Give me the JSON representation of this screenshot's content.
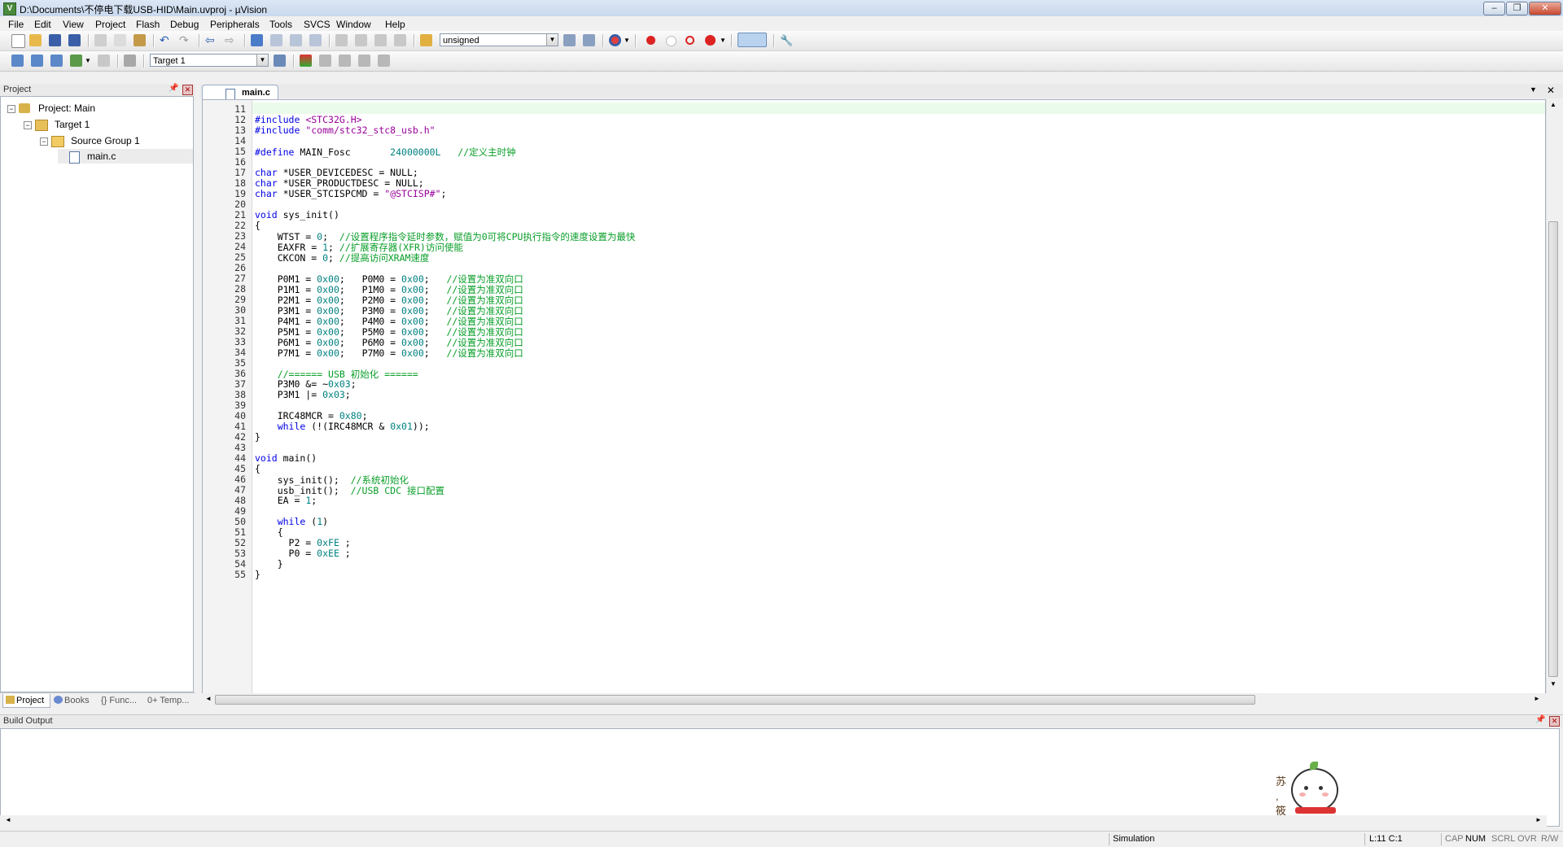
{
  "window": {
    "title": "D:\\Documents\\不停电下载USB-HID\\Main.uvproj - µVision"
  },
  "menu": [
    "File",
    "Edit",
    "View",
    "Project",
    "Flash",
    "Debug",
    "Peripherals",
    "Tools",
    "SVCS",
    "Window",
    "Help"
  ],
  "toolbar": {
    "type_combo": "unsigned",
    "target_combo": "Target 1"
  },
  "project_panel": {
    "header": "Project",
    "tree": {
      "project": "Project: Main",
      "target": "Target 1",
      "group": "Source Group 1",
      "file": "main.c"
    },
    "tabs": [
      "Project",
      "Books",
      "{} Func...",
      "0+ Temp..."
    ]
  },
  "editor": {
    "tab": "main.c",
    "lines": [
      {
        "n": "11",
        "t": ""
      },
      {
        "n": "12",
        "t": "#include <STC32G.H>"
      },
      {
        "n": "13",
        "t": "#include \"comm/stc32_stc8_usb.h\""
      },
      {
        "n": "14",
        "t": ""
      },
      {
        "n": "15",
        "t": "#define MAIN_Fosc       24000000L   //定义主时钟"
      },
      {
        "n": "16",
        "t": ""
      },
      {
        "n": "17",
        "t": "char *USER_DEVICEDESC = NULL;"
      },
      {
        "n": "18",
        "t": "char *USER_PRODUCTDESC = NULL;"
      },
      {
        "n": "19",
        "t": "char *USER_STCISPCMD = \"@STCISP#\";"
      },
      {
        "n": "20",
        "t": ""
      },
      {
        "n": "21",
        "t": "void sys_init()"
      },
      {
        "n": "22",
        "t": "{"
      },
      {
        "n": "23",
        "t": "    WTST = 0;  //设置程序指令延时参数，赋值为0可将CPU执行指令的速度设置为最快"
      },
      {
        "n": "24",
        "t": "    EAXFR = 1; //扩展寄存器(XFR)访问使能"
      },
      {
        "n": "25",
        "t": "    CKCON = 0; //提高访问XRAM速度"
      },
      {
        "n": "26",
        "t": ""
      },
      {
        "n": "27",
        "t": "    P0M1 = 0x00;   P0M0 = 0x00;   //设置为准双向口"
      },
      {
        "n": "28",
        "t": "    P1M1 = 0x00;   P1M0 = 0x00;   //设置为准双向口"
      },
      {
        "n": "29",
        "t": "    P2M1 = 0x00;   P2M0 = 0x00;   //设置为准双向口"
      },
      {
        "n": "30",
        "t": "    P3M1 = 0x00;   P3M0 = 0x00;   //设置为准双向口"
      },
      {
        "n": "31",
        "t": "    P4M1 = 0x00;   P4M0 = 0x00;   //设置为准双向口"
      },
      {
        "n": "32",
        "t": "    P5M1 = 0x00;   P5M0 = 0x00;   //设置为准双向口"
      },
      {
        "n": "33",
        "t": "    P6M1 = 0x00;   P6M0 = 0x00;   //设置为准双向口"
      },
      {
        "n": "34",
        "t": "    P7M1 = 0x00;   P7M0 = 0x00;   //设置为准双向口"
      },
      {
        "n": "35",
        "t": ""
      },
      {
        "n": "36",
        "t": "    //====== USB 初始化 ======"
      },
      {
        "n": "37",
        "t": "    P3M0 &= ~0x03;"
      },
      {
        "n": "38",
        "t": "    P3M1 |= 0x03;"
      },
      {
        "n": "39",
        "t": ""
      },
      {
        "n": "40",
        "t": "    IRC48MCR = 0x80;"
      },
      {
        "n": "41",
        "t": "    while (!(IRC48MCR & 0x01));"
      },
      {
        "n": "42",
        "t": "}"
      },
      {
        "n": "43",
        "t": ""
      },
      {
        "n": "44",
        "t": "void main()"
      },
      {
        "n": "45",
        "t": "{"
      },
      {
        "n": "46",
        "t": "    sys_init();  //系统初始化"
      },
      {
        "n": "47",
        "t": "    usb_init();  //USB CDC 接口配置"
      },
      {
        "n": "48",
        "t": "    EA = 1;"
      },
      {
        "n": "49",
        "t": ""
      },
      {
        "n": "50",
        "t": "    while (1)"
      },
      {
        "n": "51",
        "t": "    {"
      },
      {
        "n": "52",
        "t": "      P2 = 0xFE ;"
      },
      {
        "n": "53",
        "t": "      P0 = 0xEE ;"
      },
      {
        "n": "54",
        "t": "    }"
      },
      {
        "n": "55",
        "t": "}"
      }
    ]
  },
  "build_output": {
    "header": "Build Output",
    "mascot_text": "苏 , 筱"
  },
  "status": {
    "mode": "Simulation",
    "position": "L:11 C:1",
    "flags": [
      "CAP",
      "NUM",
      "SCRL",
      "OVR",
      "R/W"
    ]
  },
  "colors": {
    "keyword": "#0000e6",
    "string": "#990099",
    "number": "#008080",
    "comment": "#089e28"
  }
}
